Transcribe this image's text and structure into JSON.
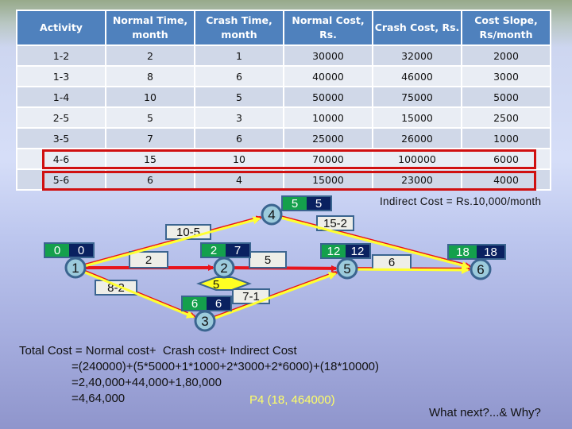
{
  "table": {
    "headers": [
      "Activity",
      "Normal Time, month",
      "Crash Time, month",
      "Normal Cost, Rs.",
      "Crash Cost, Rs.",
      "Cost Slope, Rs/month"
    ],
    "rows": [
      [
        "1-2",
        "2",
        "1",
        "30000",
        "32000",
        "2000"
      ],
      [
        "1-3",
        "8",
        "6",
        "40000",
        "46000",
        "3000"
      ],
      [
        "1-4",
        "10",
        "5",
        "50000",
        "75000",
        "5000"
      ],
      [
        "2-5",
        "5",
        "3",
        "10000",
        "15000",
        "2500"
      ],
      [
        "3-5",
        "7",
        "6",
        "25000",
        "26000",
        "1000"
      ],
      [
        "4-6",
        "15",
        "10",
        "70000",
        "100000",
        "6000"
      ],
      [
        "5-6",
        "6",
        "4",
        "15000",
        "23000",
        "4000"
      ]
    ],
    "highlighted_rows": [
      "4-6",
      "5-6"
    ]
  },
  "network": {
    "nodes": [
      {
        "id": "1",
        "early": "0",
        "late": "0"
      },
      {
        "id": "2",
        "early": "2",
        "late": "7"
      },
      {
        "id": "3",
        "early": "6",
        "late": "6"
      },
      {
        "id": "4",
        "early": "5",
        "late": "5"
      },
      {
        "id": "5",
        "early": "12",
        "late": "12"
      },
      {
        "id": "6",
        "early": "18",
        "late": "18"
      }
    ],
    "edges": [
      {
        "from": "1",
        "to": "4",
        "label": "10-5",
        "critical": true
      },
      {
        "from": "1",
        "to": "2",
        "label": "2",
        "critical": false
      },
      {
        "from": "1",
        "to": "3",
        "label": "8-2",
        "critical": true
      },
      {
        "from": "2",
        "to": "5",
        "label": "5",
        "critical": false
      },
      {
        "from": "3",
        "to": "5",
        "label": "7-1",
        "critical": true
      },
      {
        "from": "4",
        "to": "6",
        "label": "15-2",
        "critical": true
      },
      {
        "from": "5",
        "to": "6",
        "label": "6",
        "critical": true
      }
    ],
    "slack_badge": {
      "node": "2",
      "value": "5"
    },
    "colors": {
      "edge": "#e8141c",
      "critical_path": "#ffff33",
      "node_fill": "#9ccbdc",
      "node_stroke": "#3b6590",
      "early_box": "#14a04c",
      "late_box": "#0a2160",
      "label_box": "#eeeee8"
    }
  },
  "indirect_cost": "Indirect Cost = Rs.10,000/month",
  "calculation": {
    "line1": "Total Cost = Normal cost+  Crash cost+ Indirect Cost",
    "line2": "=(240000)+(5*5000+1*1000+2*3000+2*6000)+(18*10000)",
    "line3": "=2,40,000+44,000+1,80,000",
    "line4": "=4,64,000"
  },
  "point_label": "P4 (18, 464000)",
  "question": "What next?...&  Why?"
}
